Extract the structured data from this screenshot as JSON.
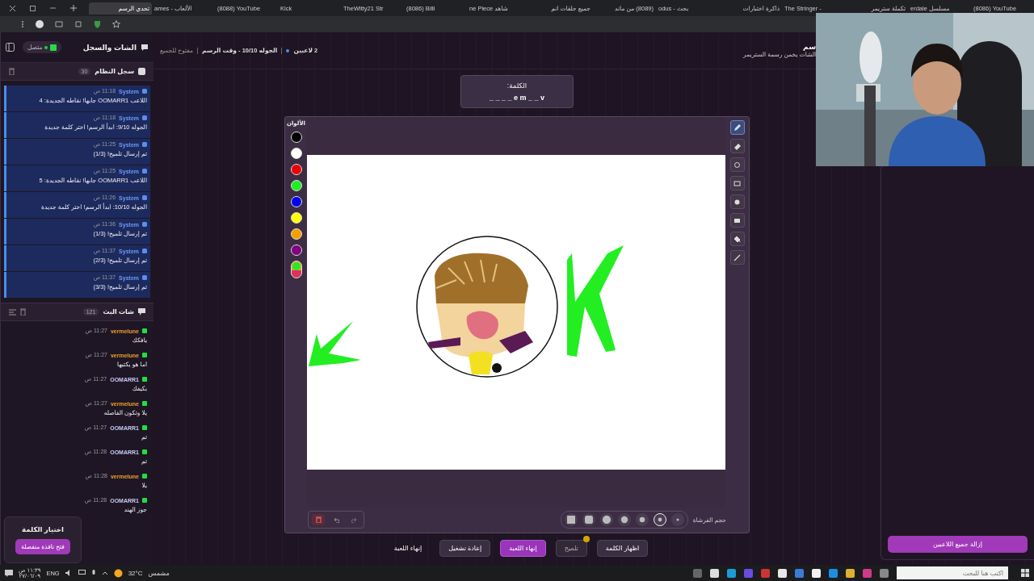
{
  "browser": {
    "tabs": [
      {
        "label": "(8086) YouTube",
        "selected": false
      },
      {
        "label": "erdale مسلسل",
        "selected": false
      },
      {
        "label": "تكملة ستريمر",
        "selected": false
      },
      {
        "label": "The Stringer -",
        "selected": false
      },
      {
        "label": "ذاكرة اختبارات",
        "selected": false
      },
      {
        "label": "odus - بحث",
        "selected": false
      },
      {
        "label": "(8089) من ماند",
        "selected": false
      },
      {
        "label": "جميع حلقات انم",
        "selected": false
      },
      {
        "label": "ne Piece شاهد",
        "selected": false
      },
      {
        "label": "(8086) Billi",
        "selected": false
      },
      {
        "label": "TheWitty21 Str",
        "selected": false
      },
      {
        "label": "Kick",
        "selected": false
      },
      {
        "label": "(8088) YouTube",
        "selected": false
      },
      {
        "label": "ames - الألعاب",
        "selected": false
      },
      {
        "label": "تحدي الرسم",
        "selected": true
      }
    ]
  },
  "sidebar": {
    "title": "الشات والسجل",
    "status": "متصل",
    "system_log": {
      "title": "سجل النظام",
      "count": "30",
      "entries": [
        {
          "author": "System",
          "time": "11:18 ص",
          "text": "اللاعب OOMARR1 جابها! نقاطه الجديدة: 4"
        },
        {
          "author": "System",
          "time": "11:18 ص",
          "text": "الجوله 9/10: ابدأ الرسم! اختر كلمة جديدة"
        },
        {
          "author": "System",
          "time": "11:25 ص",
          "text": "تم إرسال تلميح! (1/3)"
        },
        {
          "author": "System",
          "time": "11:25 ص",
          "text": "اللاعب OOMARR1 جابها! نقاطه الجديدة: 5"
        },
        {
          "author": "System",
          "time": "11:26 ص",
          "text": "الجوله 10/10: ابدأ الرسم! اختر كلمة جديدة"
        },
        {
          "author": "System",
          "time": "11:36 ص",
          "text": "تم إرسال تلميح! (1/3)"
        },
        {
          "author": "System",
          "time": "11:37 ص",
          "text": "تم إرسال تلميح! (2/3)"
        },
        {
          "author": "System",
          "time": "11:37 ص",
          "text": "تم إرسال تلميح! (3/3)"
        }
      ]
    },
    "stream_chat": {
      "title": "شات البث",
      "count": "121",
      "messages": [
        {
          "author": "vermelune",
          "color": "#f0a030",
          "time": "11:27 ص",
          "text": "يافكك"
        },
        {
          "author": "vermelune",
          "color": "#f0a030",
          "time": "11:27 ص",
          "text": "اما هو يكتبها"
        },
        {
          "author": "OOMARR1",
          "color": "#c4cdf0",
          "time": "11:27 ص",
          "text": "بكيفك"
        },
        {
          "author": "vermelune",
          "color": "#f0a030",
          "time": "11:27 ص",
          "text": "يلا وتكون الفاصله"
        },
        {
          "author": "OOMARR1",
          "color": "#c4cdf0",
          "time": "11:27 ص",
          "text": "تم"
        },
        {
          "author": "OOMARR1",
          "color": "#c4cdf0",
          "time": "11:28 ص",
          "text": "تم"
        },
        {
          "author": "vermelune",
          "color": "#f0a030",
          "time": "11:28 ص",
          "text": "يلا"
        },
        {
          "author": "OOMARR1",
          "color": "#c4cdf0",
          "time": "11:28 ص",
          "text": "جوز الهند"
        }
      ]
    },
    "word_picker": {
      "title": "اختيار الكلمة",
      "button": "فتح نافذة منفصلة"
    }
  },
  "header": {
    "title": "سم",
    "subtitle": "الشات يخمن رسمة الستريمر",
    "players": "2 لاعبين",
    "round": "الجوله 10/10 - وقت الرسم",
    "access": "مفتوح للجميع"
  },
  "word": {
    "label": "الكلمة:",
    "pattern": "_ _ _ _ e m _ _ v"
  },
  "palette": {
    "title": "الألوان",
    "colors": [
      {
        "kind": "swatch",
        "color": "#000000"
      },
      {
        "kind": "swatch",
        "color": "#ffffff"
      },
      {
        "kind": "swatch",
        "color": "#ee0000"
      },
      {
        "kind": "swatch",
        "color": "#22ee22"
      },
      {
        "kind": "swatch",
        "color": "#0000ee"
      },
      {
        "kind": "swatch",
        "color": "#ffff00"
      },
      {
        "kind": "swatch",
        "color": "#f5a000"
      },
      {
        "kind": "swatch",
        "color": "#800080"
      },
      {
        "kind": "picker"
      }
    ]
  },
  "tools": [
    {
      "kind": "pen",
      "selected": true
    },
    {
      "kind": "eraser",
      "selected": false
    },
    {
      "kind": "circle",
      "selected": false
    },
    {
      "kind": "rect",
      "selected": false
    },
    {
      "kind": "fill-circle",
      "selected": false
    },
    {
      "kind": "fill-rect",
      "selected": false
    },
    {
      "kind": "bucket",
      "selected": false
    },
    {
      "kind": "line",
      "selected": false
    }
  ],
  "brush": {
    "label": "حجم الفرشاة",
    "sizes": [
      {
        "selected": false
      },
      {
        "selected": true
      },
      {
        "selected": false
      },
      {
        "selected": false
      },
      {
        "selected": false
      },
      {
        "selected": false
      },
      {
        "selected": false
      }
    ]
  },
  "actions": [
    {
      "kind": "secondary",
      "label": "اظهار الكلمة"
    },
    {
      "kind": "hint",
      "label": "تلميح"
    },
    {
      "kind": "primary",
      "label": "إنهاء اللعبة"
    },
    {
      "kind": "secondary",
      "label": "إعادة تشغيل"
    },
    {
      "kind": "text",
      "label": "إنهاء اللعبة"
    }
  ],
  "remove_all": "إزالة جميع اللاعبين",
  "taskbar": {
    "weather_label": "مشمس",
    "temperature": "32°C",
    "language": "ENG",
    "time": "١١:٣٩ ص",
    "date": "٢٧/٠٦/٠٩",
    "search_placeholder": "اكتب هنا للبحث"
  }
}
